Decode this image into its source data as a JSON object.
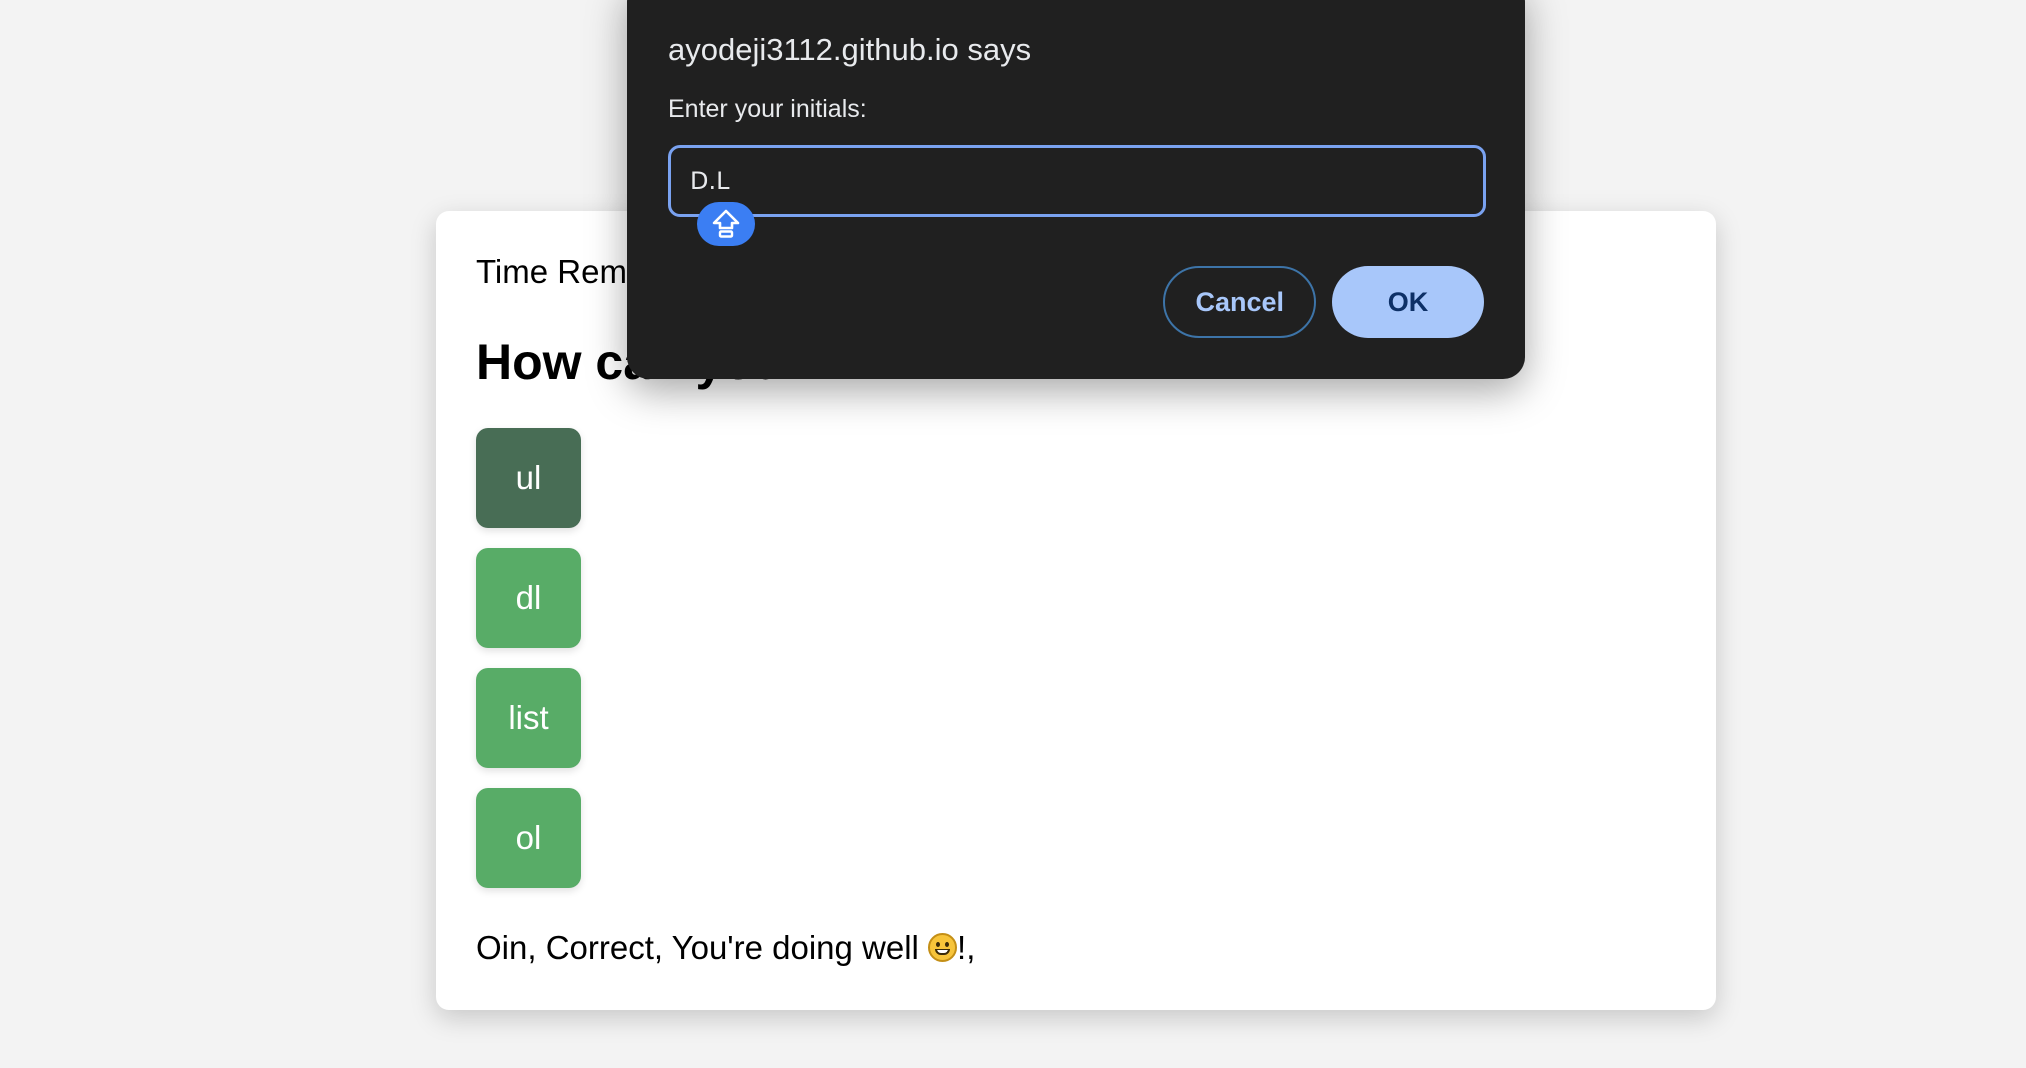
{
  "quiz": {
    "timer_label": "Time Remaining",
    "question": "How can you",
    "options": [
      {
        "label": "ul",
        "selected": true
      },
      {
        "label": "dl",
        "selected": false
      },
      {
        "label": "list",
        "selected": false
      },
      {
        "label": "ol",
        "selected": false
      }
    ],
    "feedback_prefix": "Oin, Correct, You're doing well ",
    "feedback_suffix": "!,",
    "feedback_emoji_icon": "grinning-face-icon"
  },
  "dialog": {
    "title": "ayodeji3112.github.io says",
    "message": "Enter your initials:",
    "input_value": "D.L",
    "caps_lock_icon": "caps-lock-icon",
    "cancel_label": "Cancel",
    "ok_label": "OK"
  },
  "colors": {
    "page_background": "#f3f3f3",
    "option_green": "#58ac67",
    "option_selected": "#486d55",
    "dialog_background": "#202020",
    "input_focus_border": "#7aa2f0",
    "ok_button_fill": "#a8c7fa",
    "caps_lock_badge": "#3b7ef3"
  }
}
